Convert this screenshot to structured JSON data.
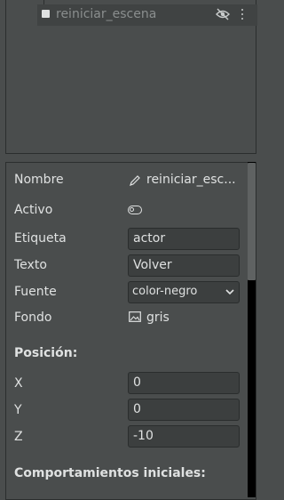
{
  "tree": {
    "item_label": "reiniciar_escena"
  },
  "properties": {
    "nombre": {
      "label": "Nombre",
      "value": "reiniciar_esc..."
    },
    "activo": {
      "label": "Activo"
    },
    "etiqueta": {
      "label": "Etiqueta",
      "value": "actor"
    },
    "texto": {
      "label": "Texto",
      "value": "Volver"
    },
    "fuente": {
      "label": "Fuente",
      "value": "color-negro"
    },
    "fondo": {
      "label": "Fondo",
      "value": "gris"
    }
  },
  "position": {
    "title": "Posición:",
    "x": {
      "label": "X",
      "value": "0"
    },
    "y": {
      "label": "Y",
      "value": "0"
    },
    "z": {
      "label": "Z",
      "value": "-10"
    }
  },
  "behaviors": {
    "title": "Comportamientos iniciales:"
  },
  "icons": {
    "eye": "eye-slash-icon",
    "menu": "kebab-menu-icon",
    "pencil": "pencil-icon",
    "toggle": "toggle-icon",
    "image": "image-icon",
    "chevron": "chevron-down-icon"
  },
  "colors": {
    "background": "#4a4d4d",
    "field": "#3c3f3f",
    "text": "#dfe1e1",
    "muted_text": "#8a8e8e",
    "border": "#2b2e2e"
  }
}
